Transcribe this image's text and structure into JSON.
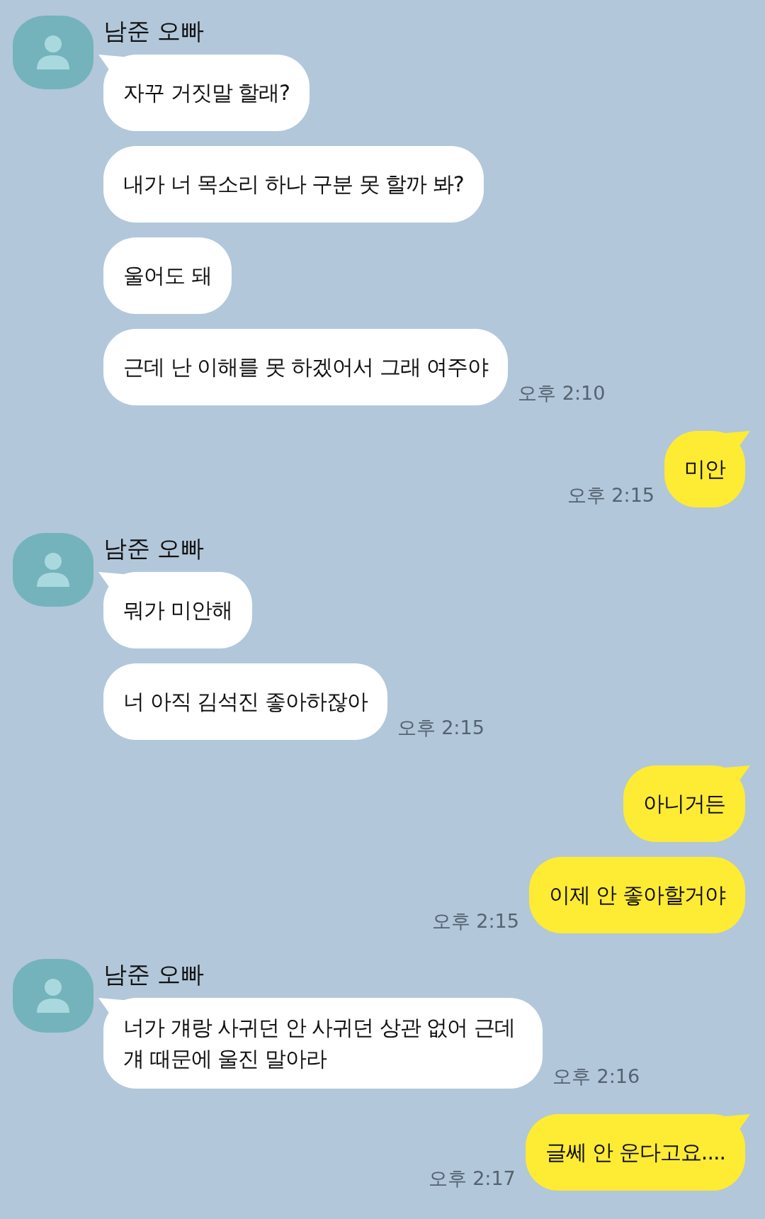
{
  "chat": [
    {
      "kind": "received",
      "sender": "남준 오빠",
      "messages": [
        "자꾸 거짓말 할래?",
        "내가 너 목소리 하나 구분 못 할까 봐?",
        "울어도 돼",
        "근데 난 이해를 못 하겠어서 그래 여주야"
      ],
      "time": "오후 2:10"
    },
    {
      "kind": "sent",
      "messages": [
        "미안"
      ],
      "time": "오후 2:15"
    },
    {
      "kind": "received",
      "sender": "남준 오빠",
      "messages": [
        "뭐가 미안해",
        "너 아직 김석진 좋아하잖아"
      ],
      "time": "오후 2:15"
    },
    {
      "kind": "sent",
      "messages": [
        "아니거든",
        "이제 안 좋아할거야"
      ],
      "time": "오후 2:15"
    },
    {
      "kind": "received",
      "sender": "남준 오빠",
      "messages": [
        "너가 걔랑 사귀던 안 사귀던 상관 없어 근데 걔 때문에 울진 말아라"
      ],
      "time": "오후 2:16"
    },
    {
      "kind": "sent",
      "messages": [
        "글쎄 안 운다고요...."
      ],
      "time": "오후 2:17"
    }
  ]
}
